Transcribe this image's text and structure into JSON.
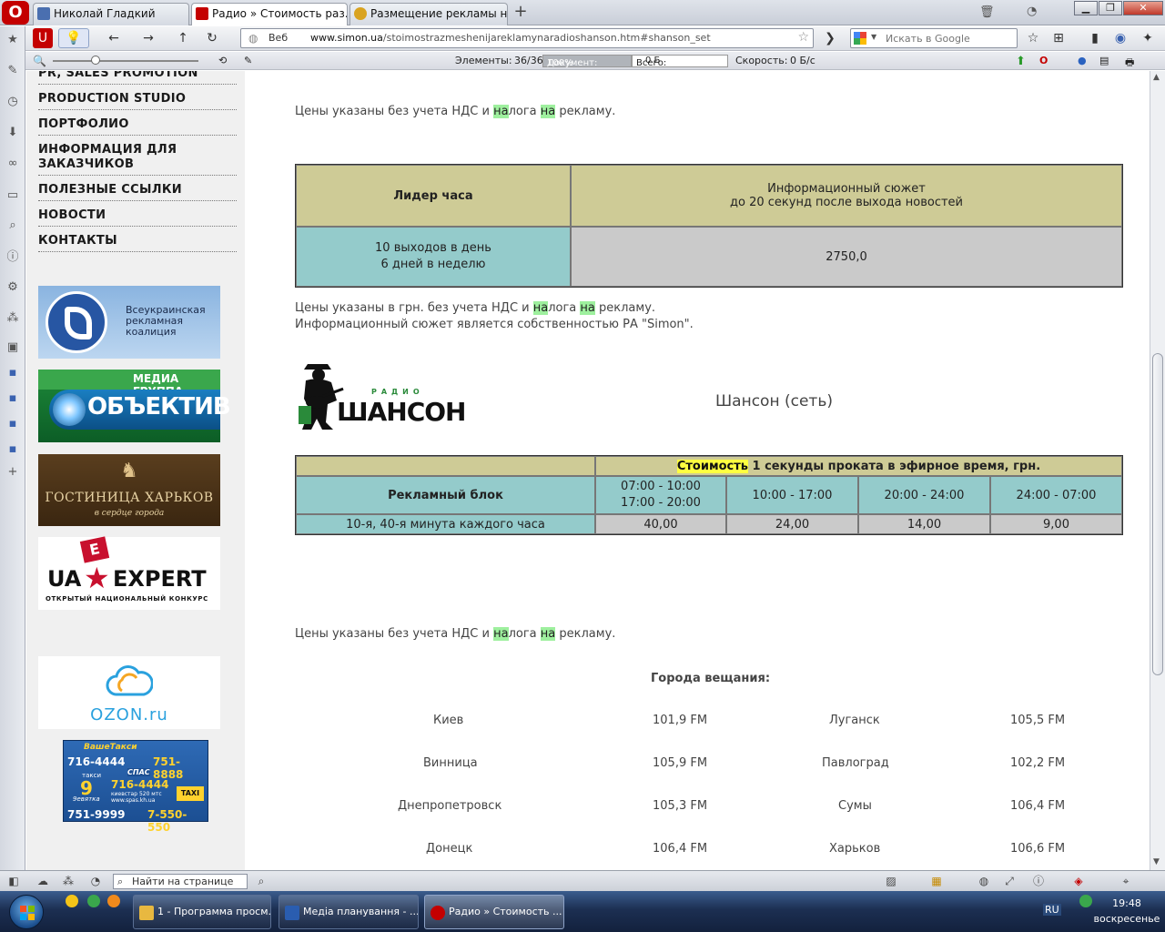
{
  "browser": {
    "tabs": [
      {
        "label": "Николай Гладкий",
        "active": false
      },
      {
        "label": "Радио » Стоимость раз...",
        "active": true
      },
      {
        "label": "Размещение рекламы н...",
        "active": false
      }
    ],
    "address": {
      "prefix": "Веб",
      "url_domain": "www.simon.ua",
      "url_path": "/stoimostrazmeshenijareklamynaradioshanson.htm#shanson_set"
    },
    "search_placeholder": "Искать в Google",
    "status": {
      "elements_label": "Элементы:",
      "elements_value": "36/36",
      "document_label": "Документ:",
      "document_value": "100%",
      "total_label": "Всего:",
      "total_value": "0 Б",
      "speed_label": "Скорость:",
      "speed_value": "0 Б/с"
    },
    "find_placeholder": "Найти на странице"
  },
  "nav": {
    "items": [
      "PR, SALES PROMOTION",
      "PRODUCTION STUDIO",
      "ПОРТФОЛИО",
      "ИНФОРМАЦИЯ ДЛЯ ЗАКАЗЧИКОВ",
      "ПОЛЕЗНЫЕ ССЫЛКИ",
      "НОВОСТИ",
      "КОНТАКТЫ"
    ]
  },
  "banners": {
    "vrk": {
      "line1": "Всеукраинская",
      "line2": "рекламная",
      "line3": "коалиция"
    },
    "media": {
      "line1": "МЕДИА ГРУППА",
      "line2": "ОБЪЕКТИВ"
    },
    "hotel": {
      "line1": "ГОСТИНИЦА ХАРЬКОВ",
      "line2": "в сердце города"
    },
    "uaexpert": {
      "line1": "UA",
      "line2": "EXPERT",
      "line3": "ОТКРЫТЫЙ НАЦИОНАЛЬНЫЙ КОНКУРС",
      "letter": "E"
    },
    "ozon": {
      "label": "OZON.ru"
    },
    "taxi": {
      "n1": "716-4444",
      "n2": "751-8888",
      "n3": "716-4444",
      "n4": "751-9999",
      "n5": "7-550-550",
      "brand": "ВашеТакси",
      "spas": "СПАС",
      "taxi": "такси",
      "nine": "9",
      "deviatka": "9евятка",
      "kyivstar": "киевстар 520 мтс",
      "site": "www.spas.kh.ua",
      "taxi_logo": "TAXI"
    }
  },
  "content": {
    "note1": {
      "before": "Цены указаны без учета НДС и ",
      "hl1": "на",
      "middle": "лога ",
      "hl2": "на",
      "after": " рекламу."
    },
    "table1": {
      "header_left": "Лидер часа",
      "header_right_1": "Информационный сюжет",
      "header_right_2": "до 20 секунд после выхода новостей",
      "row_left_1": "10 выходов в день",
      "row_left_2": "6 дней в неделю",
      "row_value": "2750,0"
    },
    "note2": {
      "before": "Цены указаны в грн. без учета НДС и ",
      "hl1": "на",
      "middle": "лога ",
      "hl2": "на",
      "after": " рекламу."
    },
    "note2b": "Информационный сюжет является собственностью РА \"Simon\".",
    "logo": {
      "radio": "РАДИО",
      "name": "ШАНСОН"
    },
    "shanson_title": "Шансон (сеть)",
    "table2": {
      "header_hl": "Стоимость",
      "header_rest": " 1 секунды проката в эфирное время, грн.",
      "block_label": "Рекламный блок",
      "slots": [
        [
          "07:00 - 10:00",
          "17:00 - 20:00"
        ],
        [
          "10:00 - 17:00"
        ],
        [
          "20:00 - 24:00"
        ],
        [
          "24:00 - 07:00"
        ]
      ],
      "row_label": "10-я, 40-я минута каждого часа",
      "prices": [
        "40,00",
        "24,00",
        "14,00",
        "9,00"
      ]
    },
    "note3": {
      "before": "Цены указаны без учета НДС и ",
      "hl1": "на",
      "middle": "лога ",
      "hl2": "на",
      "after": " рекламу."
    },
    "cities_title": "Города вещания:",
    "cities": [
      [
        "Киев",
        "101,9 FM",
        "Луганск",
        "105,5 FM"
      ],
      [
        "Винница",
        "105,9 FM",
        "Павлоград",
        "102,2 FM"
      ],
      [
        "Днепропетровск",
        "105,3 FM",
        "Сумы",
        "106,4 FM"
      ],
      [
        "Донецк",
        "106,4 FM",
        "Харьков",
        "106,6 FM"
      ]
    ]
  },
  "taskbar": {
    "tasks": [
      {
        "label": "1 - Программа просм...",
        "active": false
      },
      {
        "label": "Медіа планування - ...",
        "active": false
      },
      {
        "label": "Радио » Стоимость ...",
        "active": true
      }
    ],
    "lang": "RU",
    "time": "19:48",
    "day": "воскресенье"
  },
  "colors": {
    "olive": "#cecb96",
    "teal": "#94cbcb",
    "grey": "#cacaca",
    "highlight": "#9ef09e",
    "highlight_yellow": "#ffff40"
  }
}
